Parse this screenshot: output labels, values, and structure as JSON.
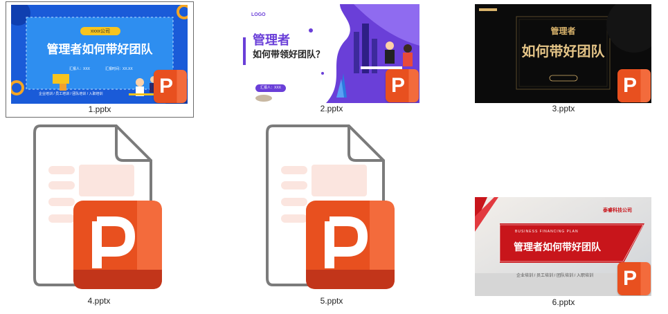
{
  "files": [
    {
      "name": "1.pptx",
      "selected": true,
      "slide": {
        "company": "xxxx公司",
        "title": "管理者如何带好团队",
        "presenter": "汇报人：XXX",
        "date": "汇报时间：XX.XX",
        "footer": "企业培训 / 员工培训 / 团队培训 / 入职培训"
      }
    },
    {
      "name": "2.pptx",
      "selected": false,
      "slide": {
        "logo": "LOGO",
        "title_line1": "管理者",
        "title_line2": "如何带领好团队？",
        "presenter": "汇报人：XXX"
      }
    },
    {
      "name": "3.pptx",
      "selected": false,
      "slide": {
        "title_line1": "管理者",
        "title_line2": "如何带好团队"
      }
    },
    {
      "name": "4.pptx",
      "selected": false
    },
    {
      "name": "5.pptx",
      "selected": false
    },
    {
      "name": "6.pptx",
      "selected": false,
      "slide": {
        "company": "泰睿科技公司",
        "subtitle": "BUSINESS FINANCING PLAN",
        "title": "管理者如何带好团队",
        "footer": "企业培训 / 员工培训 / 团队培训 / 入职培训"
      }
    }
  ],
  "badge_letter": "P",
  "colors": {
    "ppt_orange": "#e8501f",
    "ppt_light": "#f36b3c",
    "slide1_blue": "#1565e0",
    "slide2_purple": "#6a3fd8",
    "slide3_gold": "#d9b36c",
    "slide6_red": "#c8151b"
  }
}
